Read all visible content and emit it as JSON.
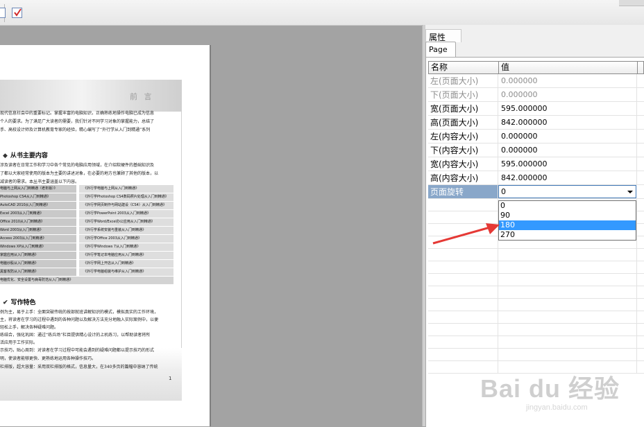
{
  "toolbar": {
    "buttons": [
      {
        "icon": "page-icon"
      },
      {
        "icon": "checkbox-icon"
      }
    ]
  },
  "document": {
    "banner_title": "前  言",
    "intro_lines": [
      "现代信息社会中的重要标记。掌握丰富的电脑知识，正确熟练地操作电脑已成为信息",
      "个人的要求。为了满足广大读者的需要，我们针对不同学习对象的掌握能力，总结了",
      "手、高校设计师及计算机教育专家的经验，精心编写了“外行学从入门到精通”系列"
    ],
    "section1_title": "从书主要内容",
    "section1_lines": [
      "涉及读者在日常工作和学习中各个常见的电脑应用领域，在介绍软硬件的基础知识及",
      "了都以大家经常使用的版本为主要的讲述对象，在必要的地方也兼顾了其他的版本，以",
      "减读者的需求。本丛书主要涵盖以下内容。"
    ],
    "books": [
      [
        "电脑与上网从入门到精通（老年版）》",
        "《外行学电脑与上网从入门到精通》"
      ],
      [
        "Photoshop CS4从入门到精通》",
        "《外行学Photoshop CS4数码照片处理从入门到精通》"
      ],
      [
        "AutoCAD 2010从入门到精通》",
        "《外行学网页制作与网站建设（CS4）从入门到精通》"
      ],
      [
        "Excel 2003从入门到精通》",
        "《外行学PowerPoint 2003从入门到精通》"
      ],
      [
        "Office 2010从入门到精通》",
        "《外行学Word/Excel办公应用从入门到精通》"
      ],
      [
        "Word 2003从入门到精通》",
        "《外行学系统安装与重装从入门到精通》"
      ],
      [
        "Access 2003从入门到精通》",
        "《外行学Office 2003从入门到精通》"
      ],
      [
        "Windows XP从入门到精通》",
        "《外行学Windows 7从入门到精通》"
      ],
      [
        "家庭应用从入门到精通》",
        "《外行学笔记本电脑应用从入门到精通》"
      ],
      [
        "电脑炒股从入门到精通》",
        "《外行学网上开店从入门到精通》"
      ],
      [
        "黑客攻防从入门到精通》",
        "《外行学电脑组装与维护从入门到精通》"
      ]
    ],
    "books_last": "电脑优化、安全设置与病毒防范从入门到精通》",
    "section2_title": "写作特色",
    "section2_lines": [
      "例为主，易于上手：全面突破传统的按部就班讲解知识的模式，模拟真实的工作环境，",
      "主，将读者在学习的过程中遇到的各种问题以及解决方法充分地融入实际案例中，以便",
      "轻松上手，解决各种疑难问题。",
      "练结合，强化巩固：通过“练兵场”栏目提供精心设计的上机练习，以帮助读者将所",
      "活应用于工作实际。",
      "示技巧，贴心周到：对读者在学习过程中可能会遇到的疑难问题都以提示技巧的形式",
      "明，使读者能够更快、更熟练地运用各种操作技巧。",
      "栏排版，超大容量：采用双栏排版的格式，信息量大，在340多页的篇幅中容纳了传统"
    ],
    "page_number": "1"
  },
  "panel": {
    "header": "属性",
    "tab": "Page",
    "columns": [
      "名称",
      "值"
    ],
    "rows": [
      {
        "name": "左(页面大小)",
        "value": "0.000000",
        "disabled": true
      },
      {
        "name": "下(页面大小)",
        "value": "0.000000",
        "disabled": true
      },
      {
        "name": "宽(页面大小)",
        "value": "595.000000",
        "disabled": false
      },
      {
        "name": "高(页面大小)",
        "value": "842.000000",
        "disabled": false
      },
      {
        "name": "左(内容大小)",
        "value": "0.000000",
        "disabled": false
      },
      {
        "name": "下(内容大小)",
        "value": "0.000000",
        "disabled": false
      },
      {
        "name": "宽(内容大小)",
        "value": "595.000000",
        "disabled": false
      },
      {
        "name": "高(内容大小)",
        "value": "842.000000",
        "disabled": false
      }
    ],
    "rotation": {
      "name": "页面旋转",
      "value": "0",
      "options": [
        "0",
        "90",
        "180",
        "270"
      ],
      "highlighted": "180"
    }
  },
  "watermark": {
    "brand": "Bai du 经验",
    "url": "jingyan.baidu.com"
  },
  "colors": {
    "accent": "#3399ff",
    "selected_row": "#89a7c9",
    "arrow": "#e53935"
  }
}
